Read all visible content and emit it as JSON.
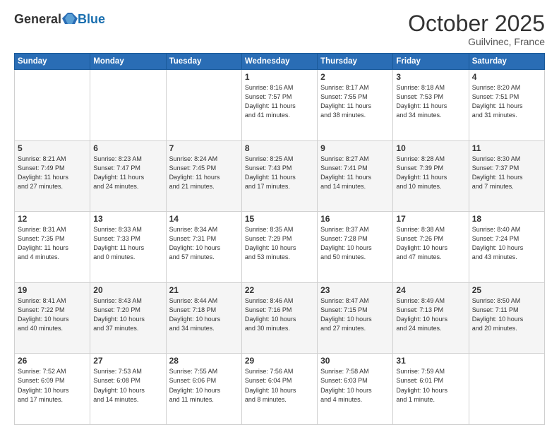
{
  "header": {
    "logo": {
      "general": "General",
      "blue": "Blue"
    },
    "title": "October 2025",
    "location": "Guilvinec, France"
  },
  "weekdays": [
    "Sunday",
    "Monday",
    "Tuesday",
    "Wednesday",
    "Thursday",
    "Friday",
    "Saturday"
  ],
  "weeks": [
    [
      {
        "day": "",
        "info": ""
      },
      {
        "day": "",
        "info": ""
      },
      {
        "day": "",
        "info": ""
      },
      {
        "day": "1",
        "info": "Sunrise: 8:16 AM\nSunset: 7:57 PM\nDaylight: 11 hours\nand 41 minutes."
      },
      {
        "day": "2",
        "info": "Sunrise: 8:17 AM\nSunset: 7:55 PM\nDaylight: 11 hours\nand 38 minutes."
      },
      {
        "day": "3",
        "info": "Sunrise: 8:18 AM\nSunset: 7:53 PM\nDaylight: 11 hours\nand 34 minutes."
      },
      {
        "day": "4",
        "info": "Sunrise: 8:20 AM\nSunset: 7:51 PM\nDaylight: 11 hours\nand 31 minutes."
      }
    ],
    [
      {
        "day": "5",
        "info": "Sunrise: 8:21 AM\nSunset: 7:49 PM\nDaylight: 11 hours\nand 27 minutes."
      },
      {
        "day": "6",
        "info": "Sunrise: 8:23 AM\nSunset: 7:47 PM\nDaylight: 11 hours\nand 24 minutes."
      },
      {
        "day": "7",
        "info": "Sunrise: 8:24 AM\nSunset: 7:45 PM\nDaylight: 11 hours\nand 21 minutes."
      },
      {
        "day": "8",
        "info": "Sunrise: 8:25 AM\nSunset: 7:43 PM\nDaylight: 11 hours\nand 17 minutes."
      },
      {
        "day": "9",
        "info": "Sunrise: 8:27 AM\nSunset: 7:41 PM\nDaylight: 11 hours\nand 14 minutes."
      },
      {
        "day": "10",
        "info": "Sunrise: 8:28 AM\nSunset: 7:39 PM\nDaylight: 11 hours\nand 10 minutes."
      },
      {
        "day": "11",
        "info": "Sunrise: 8:30 AM\nSunset: 7:37 PM\nDaylight: 11 hours\nand 7 minutes."
      }
    ],
    [
      {
        "day": "12",
        "info": "Sunrise: 8:31 AM\nSunset: 7:35 PM\nDaylight: 11 hours\nand 4 minutes."
      },
      {
        "day": "13",
        "info": "Sunrise: 8:33 AM\nSunset: 7:33 PM\nDaylight: 11 hours\nand 0 minutes."
      },
      {
        "day": "14",
        "info": "Sunrise: 8:34 AM\nSunset: 7:31 PM\nDaylight: 10 hours\nand 57 minutes."
      },
      {
        "day": "15",
        "info": "Sunrise: 8:35 AM\nSunset: 7:29 PM\nDaylight: 10 hours\nand 53 minutes."
      },
      {
        "day": "16",
        "info": "Sunrise: 8:37 AM\nSunset: 7:28 PM\nDaylight: 10 hours\nand 50 minutes."
      },
      {
        "day": "17",
        "info": "Sunrise: 8:38 AM\nSunset: 7:26 PM\nDaylight: 10 hours\nand 47 minutes."
      },
      {
        "day": "18",
        "info": "Sunrise: 8:40 AM\nSunset: 7:24 PM\nDaylight: 10 hours\nand 43 minutes."
      }
    ],
    [
      {
        "day": "19",
        "info": "Sunrise: 8:41 AM\nSunset: 7:22 PM\nDaylight: 10 hours\nand 40 minutes."
      },
      {
        "day": "20",
        "info": "Sunrise: 8:43 AM\nSunset: 7:20 PM\nDaylight: 10 hours\nand 37 minutes."
      },
      {
        "day": "21",
        "info": "Sunrise: 8:44 AM\nSunset: 7:18 PM\nDaylight: 10 hours\nand 34 minutes."
      },
      {
        "day": "22",
        "info": "Sunrise: 8:46 AM\nSunset: 7:16 PM\nDaylight: 10 hours\nand 30 minutes."
      },
      {
        "day": "23",
        "info": "Sunrise: 8:47 AM\nSunset: 7:15 PM\nDaylight: 10 hours\nand 27 minutes."
      },
      {
        "day": "24",
        "info": "Sunrise: 8:49 AM\nSunset: 7:13 PM\nDaylight: 10 hours\nand 24 minutes."
      },
      {
        "day": "25",
        "info": "Sunrise: 8:50 AM\nSunset: 7:11 PM\nDaylight: 10 hours\nand 20 minutes."
      }
    ],
    [
      {
        "day": "26",
        "info": "Sunrise: 7:52 AM\nSunset: 6:09 PM\nDaylight: 10 hours\nand 17 minutes."
      },
      {
        "day": "27",
        "info": "Sunrise: 7:53 AM\nSunset: 6:08 PM\nDaylight: 10 hours\nand 14 minutes."
      },
      {
        "day": "28",
        "info": "Sunrise: 7:55 AM\nSunset: 6:06 PM\nDaylight: 10 hours\nand 11 minutes."
      },
      {
        "day": "29",
        "info": "Sunrise: 7:56 AM\nSunset: 6:04 PM\nDaylight: 10 hours\nand 8 minutes."
      },
      {
        "day": "30",
        "info": "Sunrise: 7:58 AM\nSunset: 6:03 PM\nDaylight: 10 hours\nand 4 minutes."
      },
      {
        "day": "31",
        "info": "Sunrise: 7:59 AM\nSunset: 6:01 PM\nDaylight: 10 hours\nand 1 minute."
      },
      {
        "day": "",
        "info": ""
      }
    ]
  ]
}
